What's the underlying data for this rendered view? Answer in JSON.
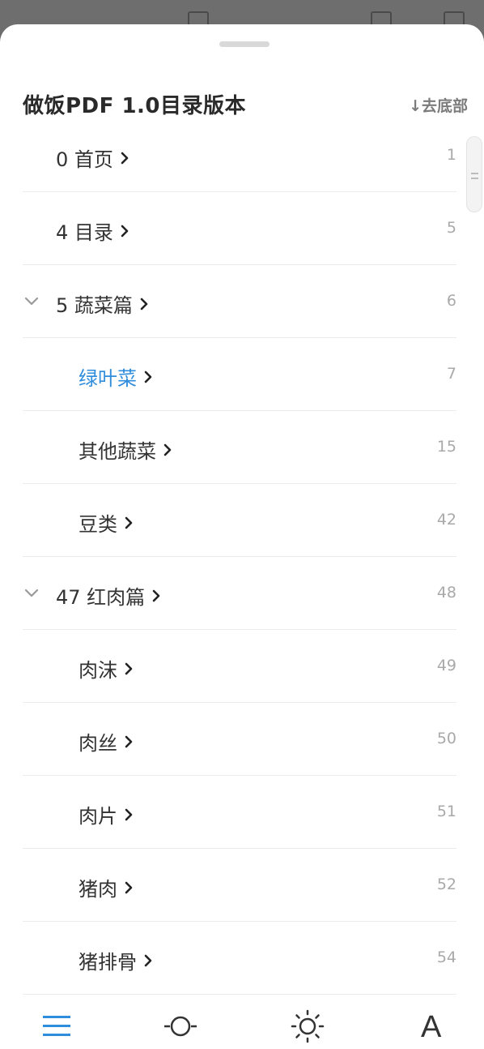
{
  "header": {
    "title": "做饭PDF 1.0目录版本",
    "goto_bottom_label": "↓去底部"
  },
  "toc": {
    "items": [
      {
        "label": "0 首页",
        "page": "1",
        "level": 0,
        "expandable": false,
        "active": false
      },
      {
        "label": "4 目录",
        "page": "5",
        "level": 0,
        "expandable": false,
        "active": false
      },
      {
        "label": "5 蔬菜篇",
        "page": "6",
        "level": 0,
        "expandable": true,
        "active": false
      },
      {
        "label": "绿叶菜",
        "page": "7",
        "level": 1,
        "expandable": false,
        "active": true
      },
      {
        "label": "其他蔬菜",
        "page": "15",
        "level": 1,
        "expandable": false,
        "active": false
      },
      {
        "label": "豆类",
        "page": "42",
        "level": 1,
        "expandable": false,
        "active": false
      },
      {
        "label": "47 红肉篇",
        "page": "48",
        "level": 0,
        "expandable": true,
        "active": false
      },
      {
        "label": "肉沫",
        "page": "49",
        "level": 1,
        "expandable": false,
        "active": false
      },
      {
        "label": "肉丝",
        "page": "50",
        "level": 1,
        "expandable": false,
        "active": false
      },
      {
        "label": "肉片",
        "page": "51",
        "level": 1,
        "expandable": false,
        "active": false
      },
      {
        "label": "猪肉",
        "page": "52",
        "level": 1,
        "expandable": false,
        "active": false
      },
      {
        "label": "猪排骨",
        "page": "54",
        "level": 1,
        "expandable": false,
        "active": false
      }
    ]
  },
  "bottom_bar": {
    "tabs": [
      {
        "icon": "list-icon",
        "active": true
      },
      {
        "icon": "progress-slider-icon",
        "active": false
      },
      {
        "icon": "brightness-icon",
        "active": false
      },
      {
        "icon": "font-size-icon",
        "label": "A",
        "active": false
      }
    ]
  },
  "colors": {
    "accent": "#2f8ddc",
    "text_primary": "#333333",
    "page_number": "#a9a9a9",
    "divider": "#ececec"
  }
}
